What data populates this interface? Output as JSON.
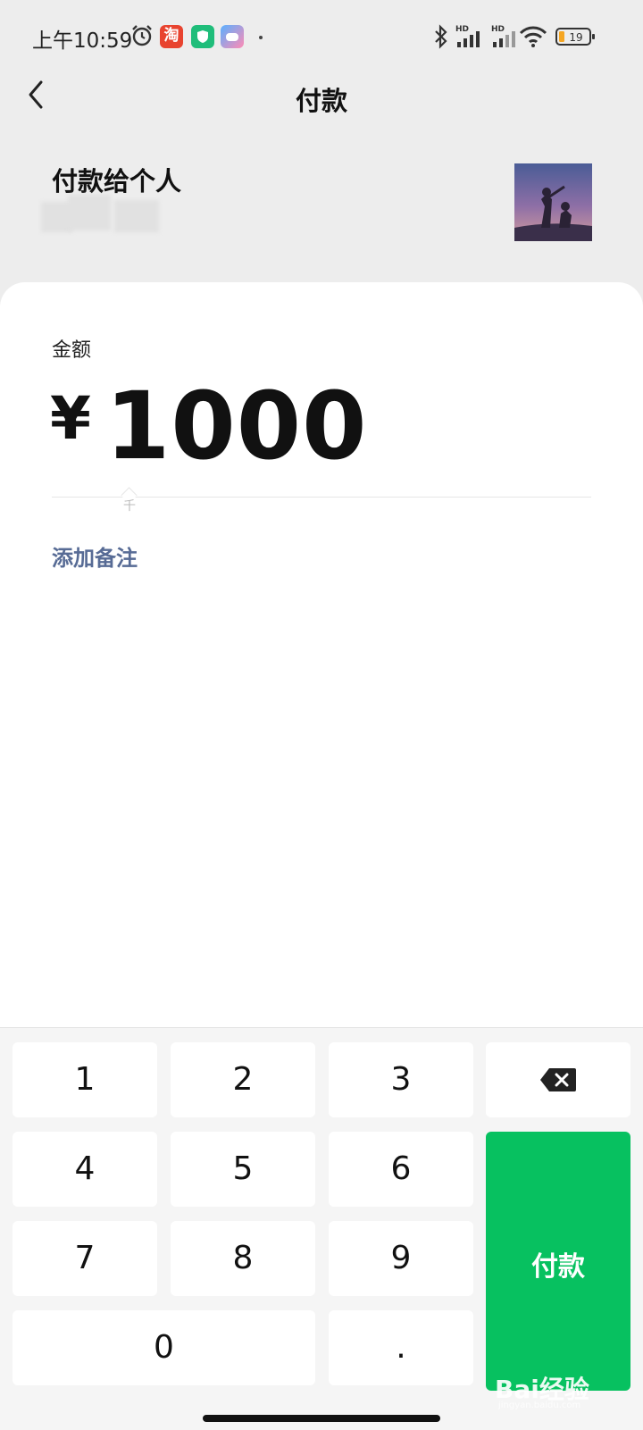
{
  "status_bar": {
    "time": "上午10:59",
    "taobao_icon_text": "淘",
    "battery": "19",
    "network_labels": [
      "HD",
      "HD"
    ]
  },
  "nav": {
    "title": "付款"
  },
  "payee": {
    "label": "付款给个人"
  },
  "amount": {
    "label": "金额",
    "currency": "¥",
    "value": "1000",
    "unit_hint": "千"
  },
  "add_note": "添加备注",
  "keypad": {
    "keys": [
      "1",
      "2",
      "3",
      "4",
      "5",
      "6",
      "7",
      "8",
      "9",
      "0",
      "."
    ],
    "pay_label": "付款"
  },
  "watermark": {
    "logo": "Bai经验",
    "sub": "jingyan.baidu.com"
  },
  "colors": {
    "pay_green": "#07c160",
    "link_blue": "#576b95",
    "background": "#ededed"
  }
}
